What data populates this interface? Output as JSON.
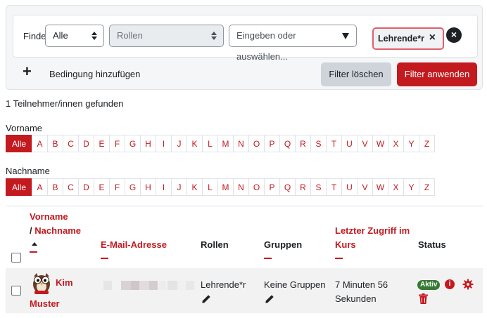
{
  "filter": {
    "match_label": "Finde",
    "match_value": "Alle",
    "type_value": "Rollen",
    "value_placeholder": "Eingeben oder auswählen...",
    "selected_tag": "Lehrende*r",
    "tag_remove": "×",
    "row_remove": "×",
    "add_condition_icon": "+",
    "add_condition_label": "Bedingung hinzufügen",
    "clear_label": "Filter löschen",
    "apply_label": "Filter anwenden"
  },
  "results_text": "1 Teilnehmer/innen gefunden",
  "firstname_filter": {
    "label": "Vorname",
    "items": [
      "Alle",
      "A",
      "B",
      "C",
      "D",
      "E",
      "F",
      "G",
      "H",
      "I",
      "J",
      "K",
      "L",
      "M",
      "N",
      "O",
      "P",
      "Q",
      "R",
      "S",
      "T",
      "U",
      "V",
      "W",
      "X",
      "Y",
      "Z"
    ],
    "active": "Alle"
  },
  "lastname_filter": {
    "label": "Nachname",
    "items": [
      "Alle",
      "A",
      "B",
      "C",
      "D",
      "E",
      "F",
      "G",
      "H",
      "I",
      "J",
      "K",
      "L",
      "M",
      "N",
      "O",
      "P",
      "Q",
      "R",
      "S",
      "T",
      "U",
      "V",
      "W",
      "X",
      "Y",
      "Z"
    ],
    "active": "Alle"
  },
  "table": {
    "headers": {
      "firstname": "Vorname",
      "separator": "/",
      "lastname": "Nachname",
      "email": "E-Mail-Adresse",
      "roles": "Rollen",
      "groups": "Gruppen",
      "lastaccess_line1": "Letzter Zugriff im",
      "lastaccess_line2": "Kurs",
      "status": "Status"
    },
    "rows": [
      {
        "firstname": "Kim",
        "lastname": "Muster",
        "role": "Lehrende*r",
        "groups": "Keine Gruppen",
        "lastaccess_line1": "7 Minuten 56",
        "lastaccess_line2": "Sekunden",
        "status": "Aktiv",
        "info_icon": "i"
      }
    ]
  },
  "colors": {
    "accent": "#c31a1f",
    "status_active": "#357a32",
    "secondary_button": "#ced4da"
  },
  "icons": [
    "plus-icon",
    "close-icon",
    "sort-up-icon",
    "pencil-icon",
    "info-icon",
    "gear-icon",
    "trash-icon",
    "avatar-owl"
  ]
}
